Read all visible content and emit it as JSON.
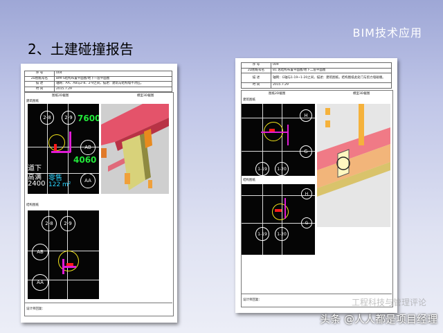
{
  "header": {
    "brand": "BIM技术应用",
    "title": "2、土建碰撞报告"
  },
  "report_left": {
    "rows": [
      {
        "label": "序  号",
        "value": "004"
      },
      {
        "label": "2D图纸号名",
        "value": "BIM-S结构布置平面图/地下一层平面图"
      },
      {
        "label": "描  述",
        "value": "轴网：AA、AB与2-8、2-9之间，描述：建筑与结构墙不对应。"
      },
      {
        "label": "时  间",
        "value": "2015.7.29"
      }
    ],
    "col_2d": "图纸2D截图",
    "col_3d": "模型3D截图",
    "sub_arch": "建筑图纸",
    "sub_struct": "结构图纸",
    "footer": "设计师回复：",
    "cad_arch": {
      "grid": [
        "2-8",
        "2-9",
        "AB",
        "AA"
      ],
      "num1": "7600",
      "num2": "4060",
      "t1": "道下",
      "t2": "高满",
      "t3": "2400",
      "t4": "零售",
      "t5": "122 m²"
    },
    "cad_struct": {
      "grid": [
        "2-8",
        "2-9",
        "AB",
        "AA"
      ]
    }
  },
  "report_right": {
    "rows": [
      {
        "label": "序  号",
        "value": "009"
      },
      {
        "label": "2D图纸号名",
        "value": "B1 总结构布置平面图/地下二层平面图"
      },
      {
        "label": "描  述",
        "value": "轴网：G轴与1-19~1-20之间，描述：建筑图纸，结构图纸此处门与剪力墙碰撞。"
      },
      {
        "label": "时  间",
        "value": "2015.7.29"
      }
    ],
    "col_2d": "图纸2D截图",
    "col_3d": "模型3D截图",
    "sub_arch": "建筑图纸",
    "sub_struct": "结构图纸",
    "footer": "设计师回复：",
    "cad_arch": {
      "grid": [
        "H",
        "G",
        "1-19",
        "1-20"
      ]
    },
    "cad_struct": {
      "grid": [
        "H",
        "G",
        "1-19",
        "1-20"
      ]
    }
  },
  "watermark": {
    "text": "头条 @人人都是项目经理",
    "faint": "工程科技与管理评论"
  },
  "colors": {
    "bg_top": "#9ea7d6",
    "bg_bottom": "#eceef7",
    "cad_green": "#22e83a",
    "cad_magenta": "#e01bd6"
  }
}
